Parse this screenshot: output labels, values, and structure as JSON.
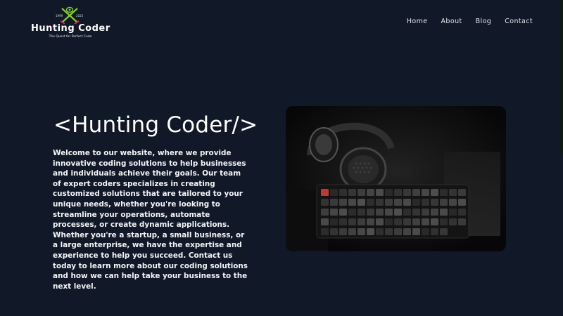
{
  "header": {
    "logo": {
      "year_left": "1999",
      "year_right": "2023",
      "title": "Hunting Coder",
      "tagline": "The Quest for Perfect Code"
    },
    "nav": {
      "items": [
        {
          "label": "Home"
        },
        {
          "label": "About"
        },
        {
          "label": "Blog"
        },
        {
          "label": "Contact"
        }
      ]
    }
  },
  "hero": {
    "title": "<Hunting Coder/>",
    "description": "Welcome to our website, where we provide innovative coding solutions to help businesses and individuals achieve their goals. Our team of expert coders specializes in creating customized solutions that are tailored to your unique needs, whether you're looking to streamline your operations, automate processes, or create dynamic applications. Whether you're a startup, a small business, or a large enterprise, we have the expertise and experience to help you succeed. Contact us today to learn more about our coding solutions and how we can help take your business to the next level."
  },
  "colors": {
    "background": "#111827",
    "logo_green": "#7dd321",
    "logo_red": "#e11d48",
    "key_accent": "#c0392b"
  }
}
